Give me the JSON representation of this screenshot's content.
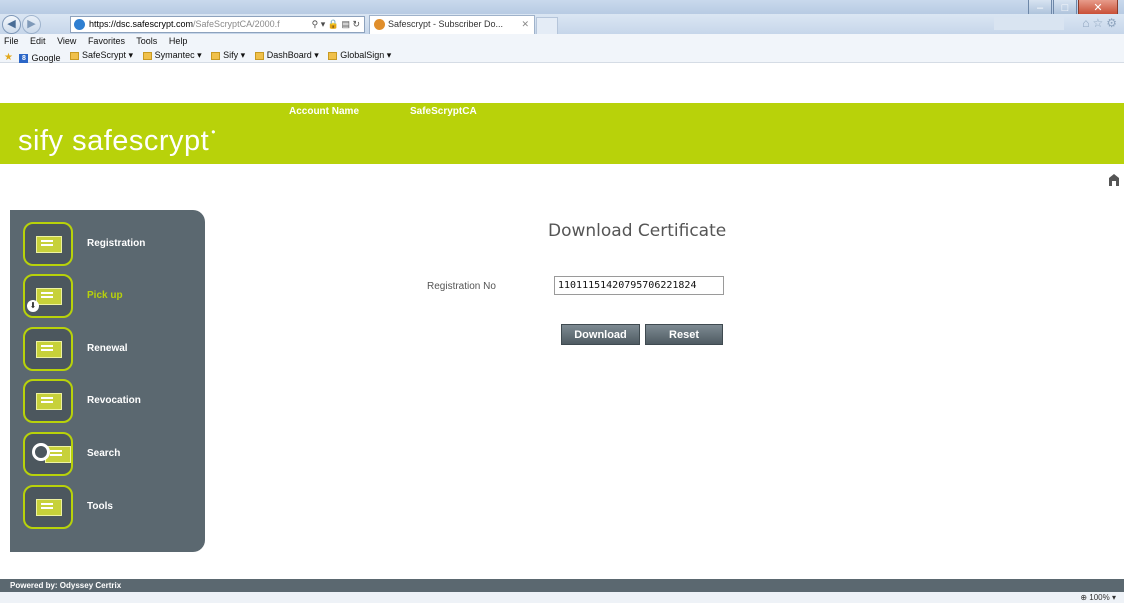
{
  "browser": {
    "address_host": "https://dsc.safescrypt.com",
    "address_path": "/SafeScryptCA/2000.f",
    "tab_title": "Safescrypt - Subscriber Do...",
    "menu": [
      "File",
      "Edit",
      "View",
      "Favorites",
      "Tools",
      "Help"
    ],
    "favorites": [
      "Google",
      "SafeScrypt ▾",
      "Symantec ▾",
      "Sify ▾",
      "DashBoard ▾",
      "GlobalSign ▾"
    ],
    "zoom": "100%"
  },
  "header": {
    "logo_sify": "sify",
    "logo_safescrypt": "safescrypt",
    "account_label": "Account Name",
    "account_value": "SafeScryptCA"
  },
  "sidebar": {
    "items": [
      {
        "label": "Registration",
        "icon": "registration-icon"
      },
      {
        "label": "Pick up",
        "icon": "pickup-icon",
        "active": true
      },
      {
        "label": "Renewal",
        "icon": "renewal-icon"
      },
      {
        "label": "Revocation",
        "icon": "revocation-icon"
      },
      {
        "label": "Search",
        "icon": "search-icon"
      },
      {
        "label": "Tools",
        "icon": "tools-icon"
      }
    ]
  },
  "form": {
    "title": "Download Certificate",
    "registration_label": "Registration No",
    "registration_value": "11011151420795706221824",
    "download_label": "Download",
    "reset_label": "Reset"
  },
  "footer": {
    "powered_by": "Powered by: Odyssey Certrix"
  },
  "colors": {
    "brand": "#b8d20a",
    "sidebar": "#5b6870"
  }
}
